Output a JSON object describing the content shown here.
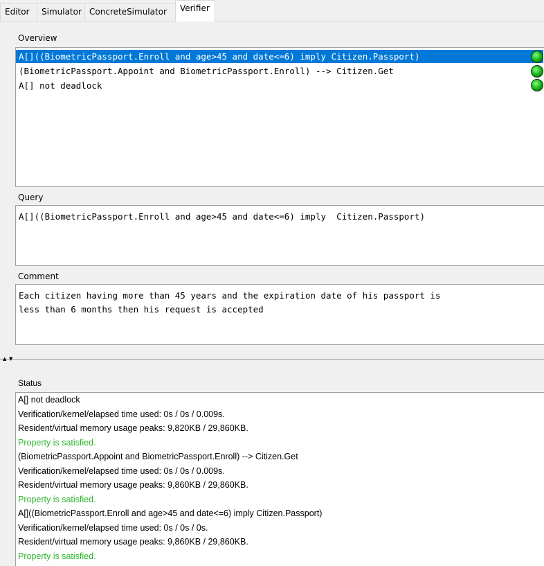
{
  "tabs": [
    {
      "label": "Editor"
    },
    {
      "label": "Simulator"
    },
    {
      "label": "ConcreteSimulator"
    },
    {
      "label": "Verifier"
    }
  ],
  "active_tab": "Verifier",
  "overview": {
    "label": "Overview",
    "queries": [
      {
        "text": "A[]((BiometricPassport.Enroll and age>45 and date<=6) imply  Citizen.Passport)",
        "status": "satisfied",
        "selected": true
      },
      {
        "text": "(BiometricPassport.Appoint and BiometricPassport.Enroll) -->  Citizen.Get",
        "status": "satisfied",
        "selected": false
      },
      {
        "text": "A[] not deadlock",
        "status": "satisfied",
        "selected": false
      }
    ]
  },
  "query": {
    "label": "Query",
    "value": "A[]((BiometricPassport.Enroll and age>45 and date<=6) imply  Citizen.Passport)"
  },
  "comment": {
    "label": "Comment",
    "value": "Each citizen having more than 45 years and the expiration date of his passport is\nless than 6 months then his request is accepted"
  },
  "status": {
    "label": "Status",
    "lines": [
      {
        "text": "A[] not deadlock",
        "type": "normal"
      },
      {
        "text": "Verification/kernel/elapsed time used: 0s / 0s / 0.009s.",
        "type": "normal"
      },
      {
        "text": "Resident/virtual memory usage peaks: 9,820KB / 29,860KB.",
        "type": "normal"
      },
      {
        "text": "Property is satisfied.",
        "type": "ok"
      },
      {
        "text": "(BiometricPassport.Appoint and BiometricPassport.Enroll) --> Citizen.Get",
        "type": "normal"
      },
      {
        "text": "Verification/kernel/elapsed time used: 0s / 0s / 0.009s.",
        "type": "normal"
      },
      {
        "text": "Resident/virtual memory usage peaks: 9,860KB / 29,860KB.",
        "type": "normal"
      },
      {
        "text": "Property is satisfied.",
        "type": "ok"
      },
      {
        "text": "A[]((BiometricPassport.Enroll and age>45 and date<=6) imply  Citizen.Passport)",
        "type": "normal"
      },
      {
        "text": "Verification/kernel/elapsed time used: 0s / 0s / 0s.",
        "type": "normal"
      },
      {
        "text": "Resident/virtual memory usage peaks: 9,860KB / 29,860KB.",
        "type": "normal"
      },
      {
        "text": "Property is satisfied.",
        "type": "ok"
      }
    ]
  },
  "colors": {
    "selection": "#0078d7",
    "satisfied_text": "#2bb52b",
    "satisfied_light": "#1fbf1f"
  }
}
